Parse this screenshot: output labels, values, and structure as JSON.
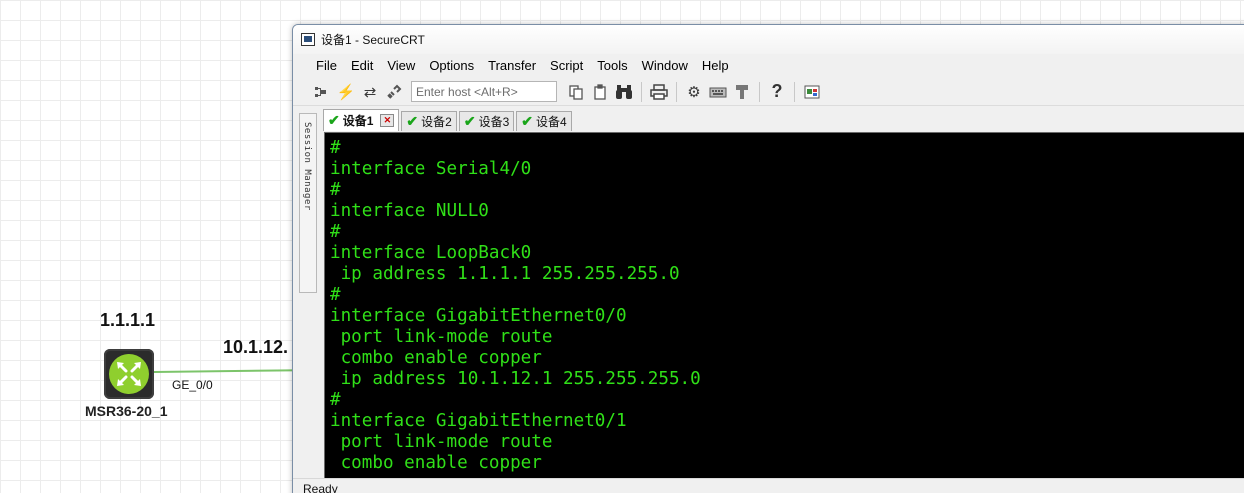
{
  "canvas": {
    "router_ip": "1.1.1.1",
    "link_ip": "10.1.12.",
    "port_label": "GE_0/0",
    "router_name": "MSR36-20_1",
    "router_icon": "router-icon",
    "link_color": "#7cc46a"
  },
  "window": {
    "title": "设备1 - SecureCRT",
    "menu": [
      "File",
      "Edit",
      "View",
      "Options",
      "Transfer",
      "Script",
      "Tools",
      "Window",
      "Help"
    ],
    "toolbar": {
      "host_placeholder": "Enter host <Alt+R>",
      "icons": [
        "connect-tree-icon",
        "quick-connect-icon",
        "reconnect-icon",
        "disconnect-icon",
        "copy-icon",
        "paste-icon",
        "find-icon",
        "print-icon",
        "settings-icon",
        "keymap-icon",
        "sftp-icon",
        "help-icon",
        "session-options-icon"
      ]
    },
    "session_manager_label": "Session Manager",
    "tabs": [
      {
        "label": "设备1",
        "active": true
      },
      {
        "label": "设备2",
        "active": false
      },
      {
        "label": "设备3",
        "active": false
      },
      {
        "label": "设备4",
        "active": false
      }
    ],
    "terminal": {
      "text_color": "#30e018",
      "background": "#000000",
      "lines": [
        "#",
        "interface Serial4/0",
        "#",
        "interface NULL0",
        "#",
        "interface LoopBack0",
        " ip address 1.1.1.1 255.255.255.0",
        "#",
        "interface GigabitEthernet0/0",
        " port link-mode route",
        " combo enable copper",
        " ip address 10.1.12.1 255.255.255.0",
        "#",
        "interface GigabitEthernet0/1",
        " port link-mode route",
        " combo enable copper"
      ]
    },
    "status": "Ready"
  }
}
